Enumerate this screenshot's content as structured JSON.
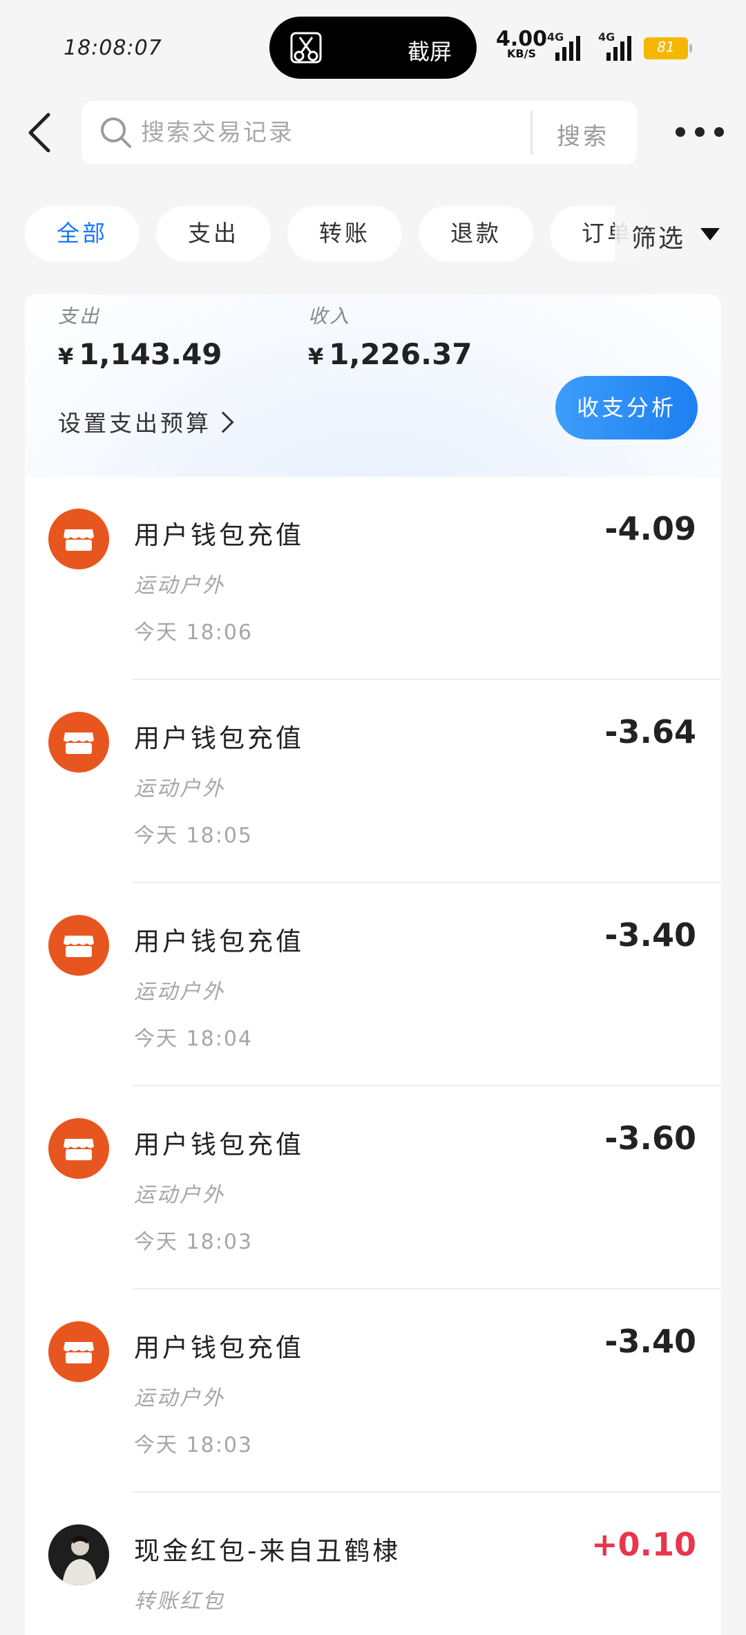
{
  "status_bar": {
    "time": "18:08:07",
    "pill_label": "截屏",
    "net_speed": "4.00",
    "net_unit": "KB/S",
    "signal1": "4G",
    "signal2": "4G",
    "battery": "81"
  },
  "header": {
    "search_placeholder": "搜索交易记录",
    "search_button": "搜索"
  },
  "tabs": [
    {
      "label": "全部",
      "active": true
    },
    {
      "label": "支出",
      "active": false
    },
    {
      "label": "转账",
      "active": false
    },
    {
      "label": "退款",
      "active": false
    },
    {
      "label": "订单",
      "active": false
    }
  ],
  "filter_label": "筛选",
  "summary": {
    "expense_label": "支出",
    "expense_currency": "¥",
    "expense_amount": "1,143.49",
    "income_label": "收入",
    "income_currency": "¥",
    "income_amount": "1,226.37",
    "budget_link": "设置支出预算",
    "analysis_button": "收支分析"
  },
  "transactions": [
    {
      "title": "用户钱包充值",
      "category": "运动户外",
      "time": "今天 18:06",
      "amount": "-4.09",
      "icon": "store-icon"
    },
    {
      "title": "用户钱包充值",
      "category": "运动户外",
      "time": "今天 18:05",
      "amount": "-3.64",
      "icon": "store-icon"
    },
    {
      "title": "用户钱包充值",
      "category": "运动户外",
      "time": "今天 18:04",
      "amount": "-3.40",
      "icon": "store-icon"
    },
    {
      "title": "用户钱包充值",
      "category": "运动户外",
      "time": "今天 18:03",
      "amount": "-3.60",
      "icon": "store-icon"
    },
    {
      "title": "用户钱包充值",
      "category": "运动户外",
      "time": "今天 18:03",
      "amount": "-3.40",
      "icon": "store-icon"
    },
    {
      "title": "现金红包-来自丑鹤棣",
      "category": "转账红包",
      "time": "",
      "amount": "+0.10",
      "icon": "user-avatar"
    }
  ],
  "colors": {
    "accent": "#1677ff",
    "store_icon_bg": "#e8561f",
    "income": "#e8364c"
  }
}
